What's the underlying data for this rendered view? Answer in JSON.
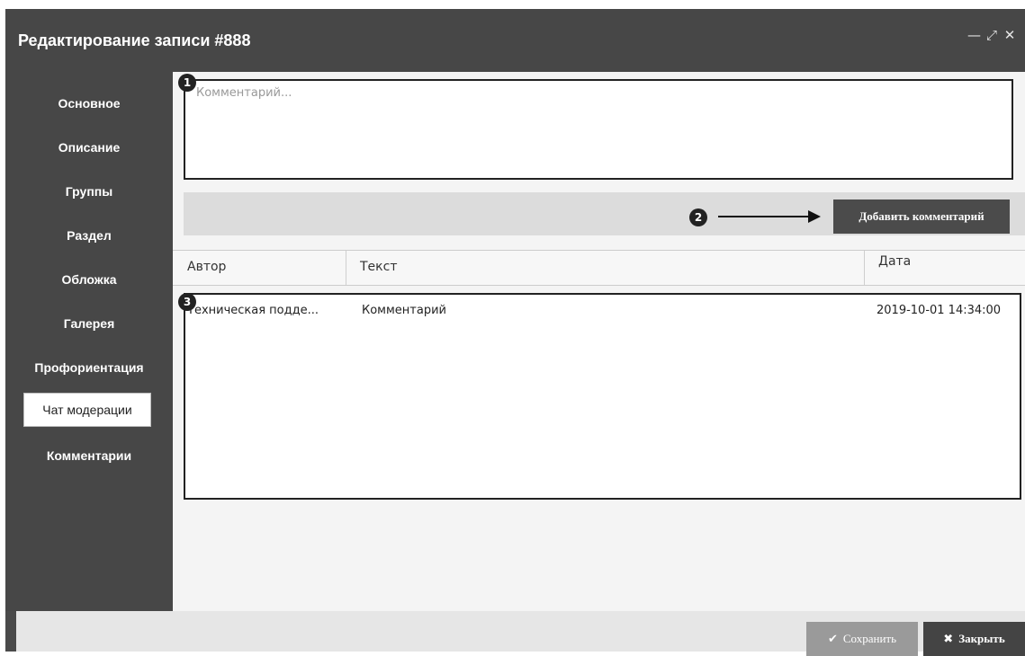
{
  "window": {
    "title": "Редактирование записи #888",
    "controls": {
      "minimize": "—",
      "maximize": "⤢",
      "close": "✕"
    }
  },
  "sidebar": {
    "items": [
      {
        "label": "Основное"
      },
      {
        "label": "Описание"
      },
      {
        "label": "Группы"
      },
      {
        "label": "Раздел"
      },
      {
        "label": "Обложка"
      },
      {
        "label": "Галерея"
      },
      {
        "label": "Профориентация"
      },
      {
        "label": "Чат модерации",
        "active": true
      },
      {
        "label": "Комментарии"
      }
    ]
  },
  "comment": {
    "placeholder": "Комментарий...",
    "value": ""
  },
  "markers": [
    "1",
    "2",
    "3"
  ],
  "add_button": {
    "label": "Добавить комментарий"
  },
  "table": {
    "columns": [
      "Автор",
      "Текст",
      "Дата"
    ],
    "rows": [
      {
        "author": "Техническая подде...",
        "text": "Комментарий",
        "date": "2019-10-01 14:34:00"
      }
    ]
  },
  "footer": {
    "save_label": "Сохранить",
    "save_icon": "✔",
    "close_label": "Закрыть",
    "close_icon": "✖"
  }
}
